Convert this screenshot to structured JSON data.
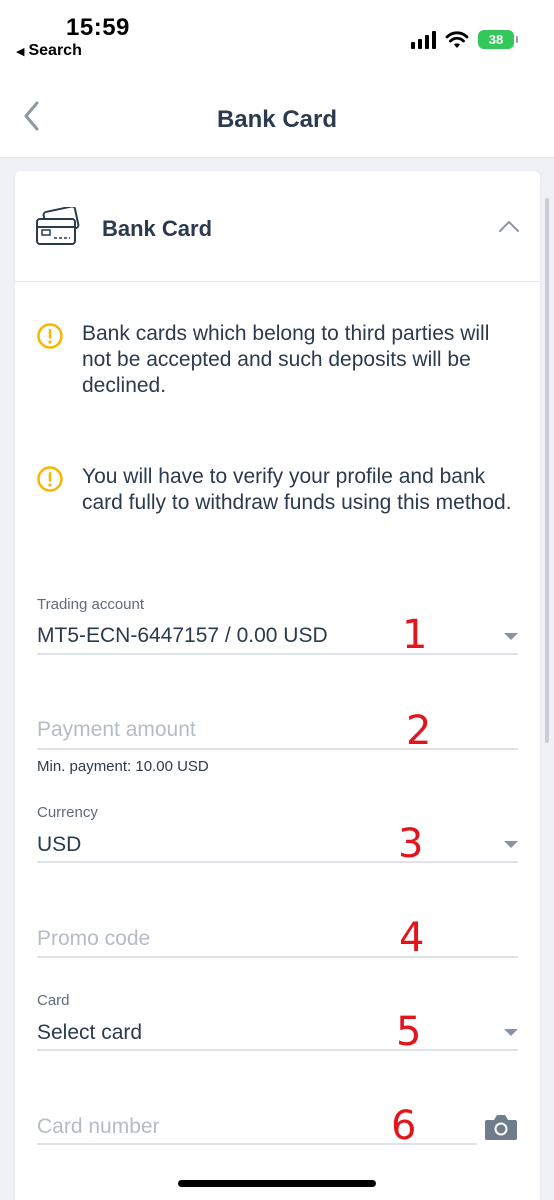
{
  "status_bar": {
    "time": "15:59",
    "back_app_label": "Search",
    "battery_level": "38"
  },
  "nav": {
    "title": "Bank Card"
  },
  "panel": {
    "title": "Bank Card",
    "notices": [
      "Bank cards which belong to third parties will not be accepted and such deposits will be declined.",
      "You will have to verify your profile and bank card fully to withdraw funds using this method."
    ]
  },
  "form": {
    "trading_account": {
      "label": "Trading account",
      "value": "MT5-ECN-6447157 / 0.00 USD"
    },
    "payment_amount": {
      "placeholder": "Payment amount",
      "hint": "Min. payment: 10.00 USD"
    },
    "currency": {
      "label": "Currency",
      "value": "USD"
    },
    "promo_code": {
      "placeholder": "Promo code"
    },
    "card": {
      "label": "Card",
      "value": "Select card"
    },
    "card_number": {
      "placeholder": "Card number"
    }
  },
  "markers": [
    "1",
    "2",
    "3",
    "4",
    "5",
    "6"
  ],
  "colors": {
    "accent_warning": "#f5b800",
    "marker_red": "#e3151c",
    "text_primary": "#2c3a4d",
    "battery_green": "#34c759"
  },
  "icons": [
    "chevron-left-icon",
    "credit-card-icon",
    "chevron-up-icon",
    "warning-circle-icon",
    "dropdown-arrow-icon",
    "camera-icon"
  ]
}
